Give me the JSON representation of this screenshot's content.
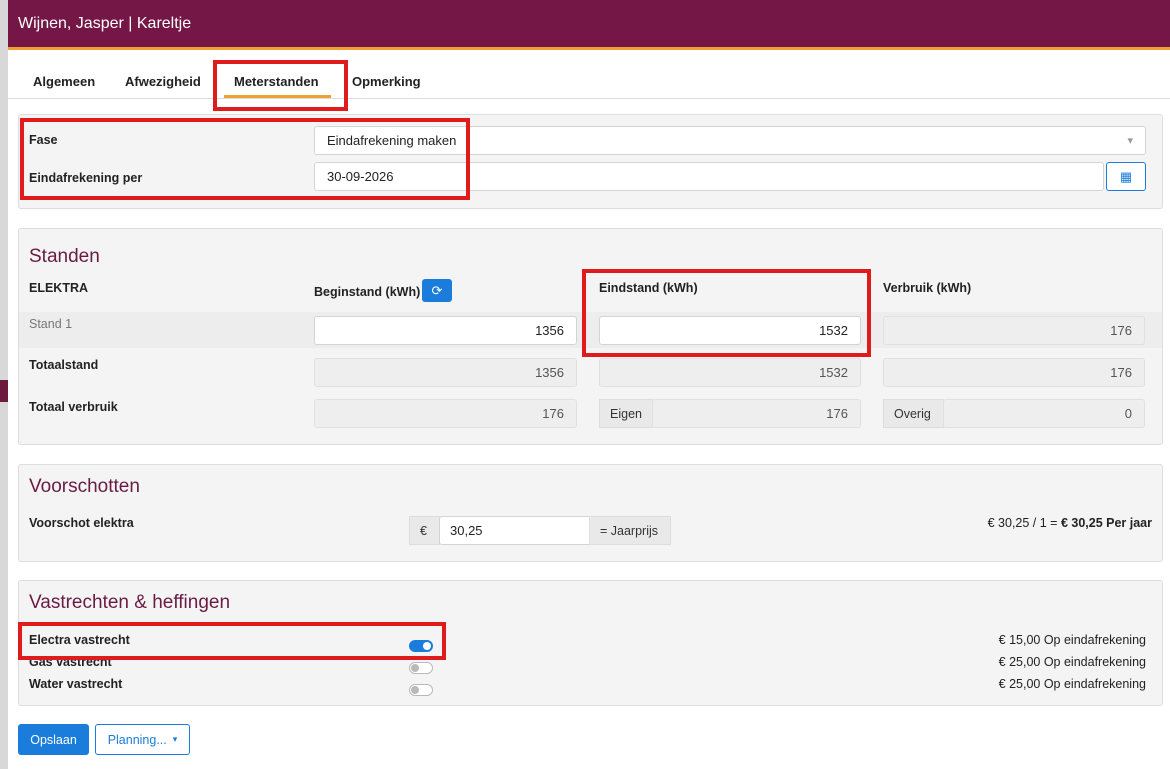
{
  "window": {
    "title": "Wijnen, Jasper | Kareltje"
  },
  "tabs": [
    {
      "label": "Algemeen"
    },
    {
      "label": "Afwezigheid"
    },
    {
      "label": "Meterstanden"
    },
    {
      "label": "Opmerking"
    }
  ],
  "fase": {
    "label": "Fase",
    "value": "Eindafrekening maken",
    "date_label": "Eindafrekening per",
    "date_value": "30-09-2026"
  },
  "standen": {
    "title": "Standen",
    "category": "ELEKTRA",
    "col_begin": "Beginstand (kWh)",
    "col_eind": "Eindstand (kWh)",
    "col_verbruik": "Verbruik (kWh)",
    "row_stand1": {
      "label": "Stand 1",
      "begin": "1356",
      "eind": "1532",
      "verbruik": "176"
    },
    "row_totaal": {
      "label": "Totaalstand",
      "begin": "1356",
      "eind": "1532",
      "verbruik": "176"
    },
    "row_verbruik": {
      "label": "Totaal verbruik",
      "begin": "176",
      "eigen_label": "Eigen",
      "eigen": "176",
      "overig_label": "Overig",
      "overig": "0"
    }
  },
  "voorschotten": {
    "title": "Voorschotten",
    "label": "Voorschot elektra",
    "currency": "€",
    "value": "30,25",
    "suffix": "= Jaarprijs",
    "summary_prefix": "€ 30,25 / 1 = ",
    "summary_bold": "€ 30,25 Per jaar"
  },
  "vastrechten": {
    "title": "Vastrechten & heffingen",
    "items": [
      {
        "label": "Electra vastrecht",
        "on": true,
        "fee": "€ 15,00 Op eindafrekening"
      },
      {
        "label": "Gas vastrecht",
        "on": false,
        "fee": "€ 25,00 Op eindafrekening"
      },
      {
        "label": "Water vastrecht",
        "on": false,
        "fee": "€ 25,00 Op eindafrekening"
      }
    ]
  },
  "footer": {
    "save_label": "Opslaan",
    "planning_label": "Planning...",
    "caret": "▾"
  },
  "icons": {
    "dropdown": "▾",
    "refresh": "⟳",
    "calendar": "▦"
  },
  "colors": {
    "brand": "#741747",
    "accent": "#f0a030",
    "primary": "#1a7ddb",
    "highlight": "#e01b1b"
  }
}
